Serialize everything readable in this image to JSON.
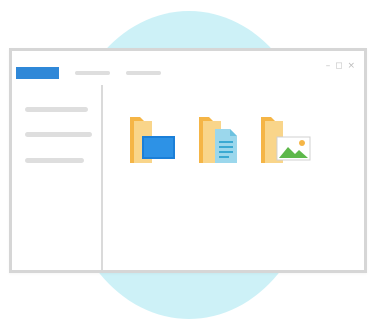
{
  "window": {
    "controls": "– ◻ ×"
  },
  "colors": {
    "background_circle": "#cdf1f7",
    "active_tab": "#2f88d8",
    "placeholder": "#dedede",
    "folder": "#f7c46b"
  },
  "tabs": [
    {
      "state": "active"
    },
    {
      "state": "inactive"
    },
    {
      "state": "inactive"
    }
  ],
  "sidebar": {
    "item_count": 3
  },
  "folders": [
    {
      "icon": "folder-with-monitor-icon"
    },
    {
      "icon": "folder-with-document-icon"
    },
    {
      "icon": "folder-with-image-icon"
    }
  ]
}
